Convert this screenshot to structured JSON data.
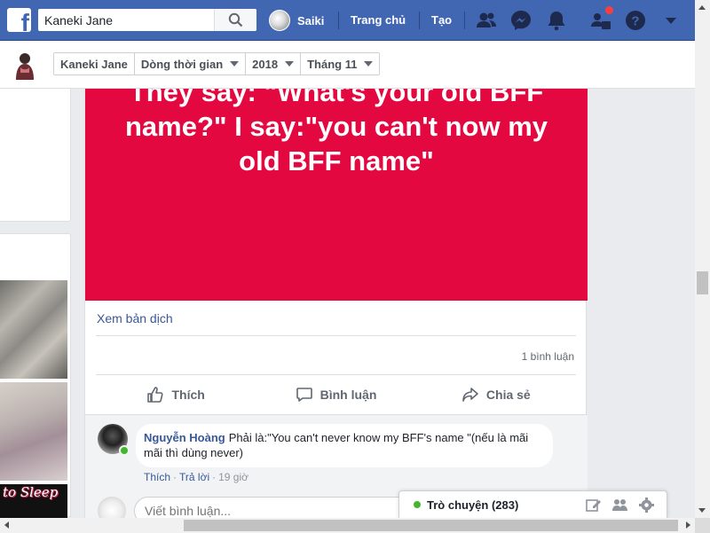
{
  "topbar": {
    "search_value": "Kaneki Jane",
    "user_name": "Saiki",
    "nav_home": "Trang chủ",
    "nav_create": "Tạo",
    "icons": [
      "friend-requests-icon",
      "messenger-icon",
      "notifications-icon",
      "quick-help-icon",
      "help-icon",
      "account-menu-icon"
    ],
    "colors": {
      "brand": "#4267b2",
      "badge": "#fa3e3e"
    }
  },
  "subbar": {
    "crumbs": [
      {
        "label": "Kaneki Jane"
      },
      {
        "label": "Dòng thời gian"
      },
      {
        "label": "2018"
      },
      {
        "label": "Tháng 11"
      }
    ]
  },
  "post": {
    "banner_text": "They say: \"What's your old BFF name?\" I say:\"you can't now my old BFF name\"",
    "banner_color": "#e3083f",
    "translate_link": "Xem bản dịch",
    "comment_count": "1 bình luận",
    "actions": {
      "like": "Thích",
      "comment": "Bình luận",
      "share": "Chia sẻ"
    }
  },
  "comments": [
    {
      "author": "Nguyễn Hoàng",
      "text": "Phải là:\"You can't never know my BFF's name \"(nếu là mãi mãi thì dùng never)",
      "like": "Thích",
      "reply": "Trả lời",
      "time": "19 giờ"
    }
  ],
  "write_comment": {
    "placeholder": "Viết bình luận..."
  },
  "sidebar": {
    "photo_caption": "to Sleep"
  },
  "chat": {
    "label": "Trò chuyện (283)"
  }
}
